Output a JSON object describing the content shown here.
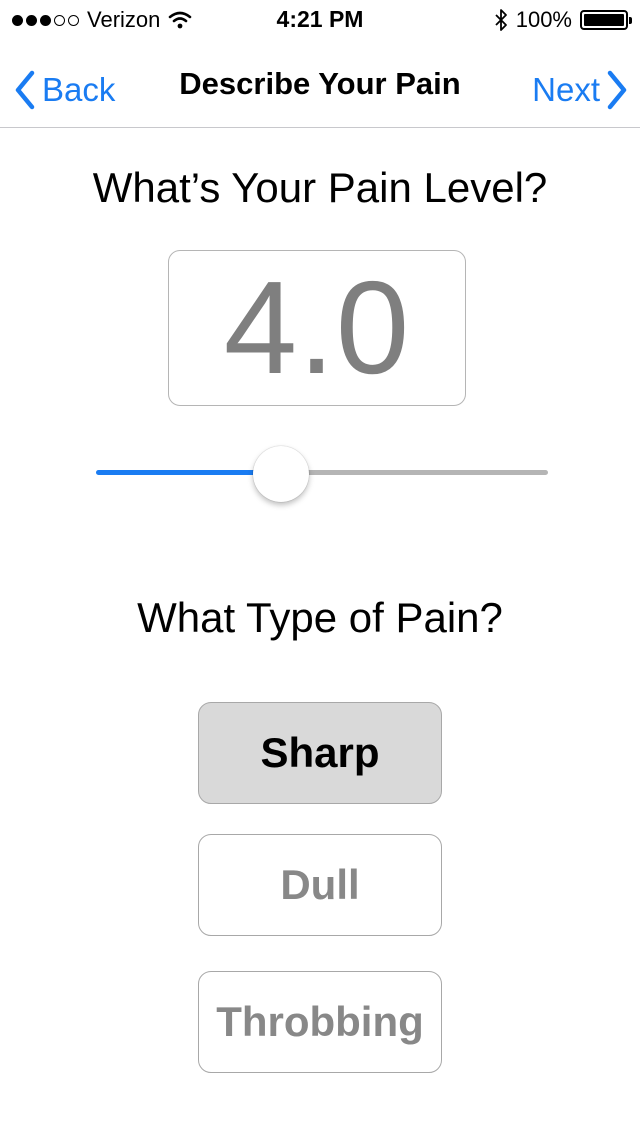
{
  "status_bar": {
    "carrier": "Verizon",
    "time": "4:21 PM",
    "battery": "100%",
    "signal_bars_filled": 3,
    "signal_bars_total": 5,
    "icons": [
      "wifi-icon",
      "bluetooth-icon",
      "battery-icon"
    ]
  },
  "nav": {
    "back_label": "Back",
    "title": "Describe Your Pain",
    "next_label": "Next",
    "accent_color": "#1a7cf2"
  },
  "pain_level": {
    "heading": "What’s Your Pain Level?",
    "value": "4.0",
    "slider_fraction": 0.41
  },
  "pain_type": {
    "heading": "What Type of Pain?",
    "options": [
      {
        "label": "Sharp",
        "selected": true
      },
      {
        "label": "Dull",
        "selected": false
      },
      {
        "label": "Throbbing",
        "selected": false
      }
    ]
  }
}
